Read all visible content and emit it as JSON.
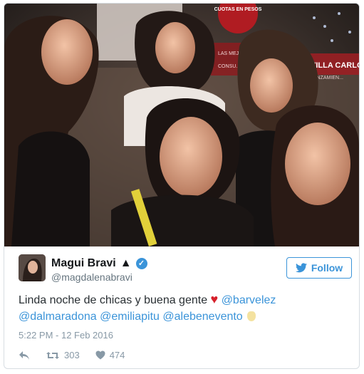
{
  "tweet": {
    "display_name": "Magui Bravi",
    "name_glyph": "▲",
    "verified_mark": "✓",
    "handle": "@magdalenabravi",
    "follow_label": "Follow",
    "text_prefix": "Linda noche de chicas y buena gente",
    "heart": "♥",
    "mentions": [
      "@barvelez",
      "@dalmaradona",
      "@emiliapitu",
      "@alebenevento"
    ],
    "timestamp": "5:22 PM - 12 Feb 2016",
    "retweets": "303",
    "likes": "474"
  },
  "photo": {
    "sign_text": "CUOTAS EN PESOS",
    "sign_lines": [
      "LAS MEJORES",
      "CONSU..."
    ],
    "villa_text": "VILLA CARLOS",
    "lanzamiento_text": "LANZAMIEN..."
  },
  "icons": {
    "reply": "reply-icon",
    "retweet": "retweet-icon",
    "like": "heart-icon",
    "follow": "twitter-bird-icon",
    "verified": "verified-badge-icon"
  },
  "colors": {
    "accent": "#3b94d9",
    "name": "#14171a",
    "muted": "#8899a6",
    "heart": "#d6202b"
  }
}
